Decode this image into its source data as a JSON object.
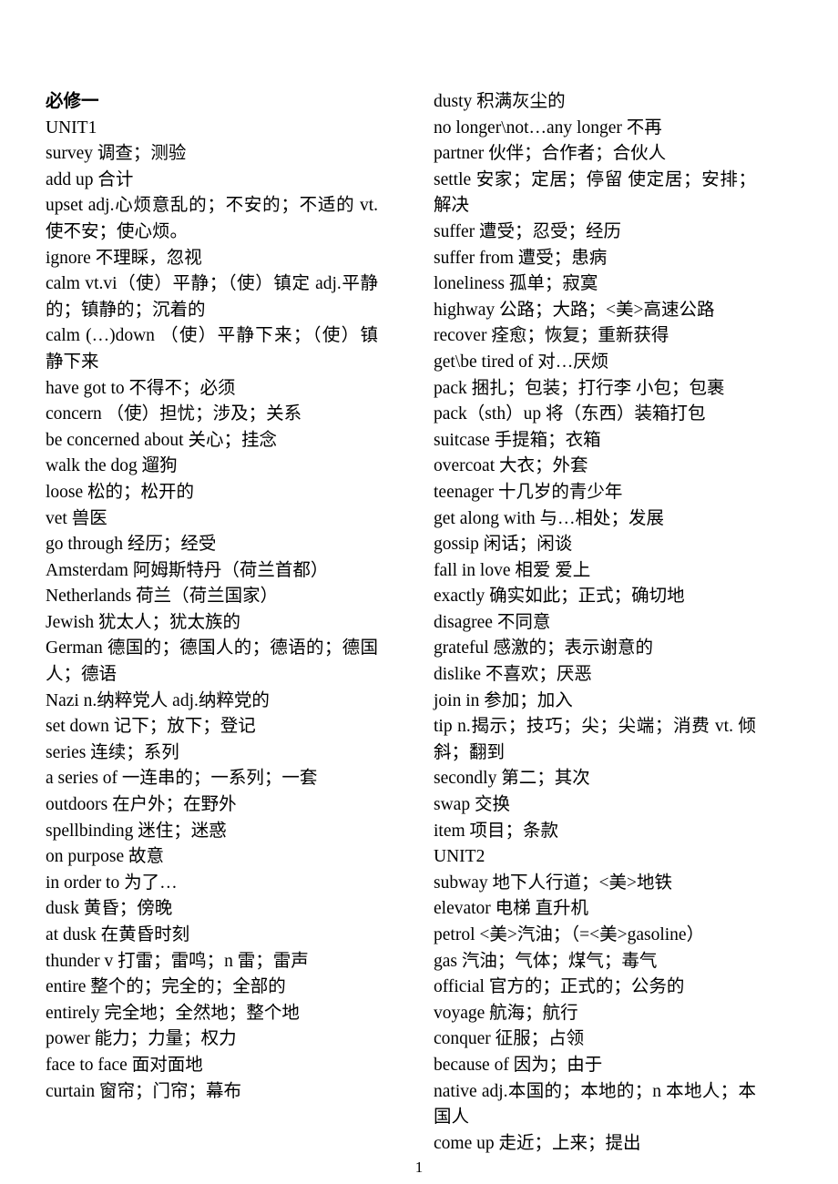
{
  "document": {
    "page_number": "1",
    "columns": [
      {
        "id": "left",
        "entries": [
          {
            "text": "必修一",
            "bold": true
          },
          {
            "text": "UNIT1",
            "bold": false
          },
          {
            "text": "survey    调查；测验",
            "bold": false
          },
          {
            "text": "add up    合计",
            "bold": false
          },
          {
            "text": "upset       adj.心烦意乱的；不安的；不适的  vt.使不安；使心烦。",
            "bold": false
          },
          {
            "text": "ignore     不理睬，忽视",
            "bold": false
          },
          {
            "text": "calm        vt.vi（使）平静；（使）镇定 adj.平静的；镇静的；沉着的",
            "bold": false
          },
          {
            "text": "calm (…)down     （使）平静下来；（使）镇静下来",
            "bold": false
          },
          {
            "text": "have got to    不得不；必须",
            "bold": false
          },
          {
            "text": "concern     （使）担忧；涉及；关系",
            "bold": false
          },
          {
            "text": "be concerned about    关心；挂念",
            "bold": false
          },
          {
            "text": "walk the dog  遛狗",
            "bold": false
          },
          {
            "text": "loose    松的；松开的",
            "bold": false
          },
          {
            "text": "vet    兽医",
            "bold": false
          },
          {
            "text": "go through    经历；经受",
            "bold": false
          },
          {
            "text": "Amsterdam    阿姆斯特丹（荷兰首都）",
            "bold": false
          },
          {
            "text": "Netherlands   荷兰（荷兰国家）",
            "bold": false
          },
          {
            "text": "Jewish   犹太人；犹太族的",
            "bold": false
          },
          {
            "text": "German  德国的；德国人的；德语的；德国人；德语",
            "bold": false
          },
          {
            "text": "Nazi    n.纳粹党人 adj.纳粹党的",
            "bold": false
          },
          {
            "text": "set down  记下；放下；登记",
            "bold": false
          },
          {
            "text": "series    连续；系列",
            "bold": false
          },
          {
            "text": "a series of    一连串的；一系列；一套",
            "bold": false
          },
          {
            "text": "outdoors    在户外；在野外",
            "bold": false
          },
          {
            "text": "spellbinding     迷住；迷惑",
            "bold": false
          },
          {
            "text": "on purpose  故意",
            "bold": false
          },
          {
            "text": "in order to    为了…",
            "bold": false
          },
          {
            "text": "dusk  黄昏；傍晚",
            "bold": false
          },
          {
            "text": "at dusk  在黄昏时刻",
            "bold": false
          },
          {
            "text": "thunder    v 打雷；雷鸣；n 雷；雷声",
            "bold": false
          },
          {
            "text": "entire    整个的；完全的；全部的",
            "bold": false
          },
          {
            "text": "entirely    完全地；全然地；整个地",
            "bold": false
          },
          {
            "text": "power    能力；力量；权力",
            "bold": false
          },
          {
            "text": "face to face  面对面地",
            "bold": false
          },
          {
            "text": "curtain  窗帘；门帘；幕布",
            "bold": false
          }
        ]
      },
      {
        "id": "right",
        "entries": [
          {
            "text": "dusty  积满灰尘的",
            "bold": false
          },
          {
            "text": "no longer\\not…any longer  不再",
            "bold": false
          },
          {
            "text": "partner    伙伴；合作者；合伙人",
            "bold": false
          },
          {
            "text": "settle    安家；定居；停留 使定居；安排；解决",
            "bold": false
          },
          {
            "text": "suffer    遭受；忍受；经历",
            "bold": false
          },
          {
            "text": "suffer from  遭受；患病",
            "bold": false
          },
          {
            "text": "loneliness    孤单；寂寞",
            "bold": false
          },
          {
            "text": "highway  公路；大路；<美>高速公路",
            "bold": false
          },
          {
            "text": "recover    痊愈；恢复；重新获得",
            "bold": false
          },
          {
            "text": "get\\be tired of   对…厌烦",
            "bold": false
          },
          {
            "text": "pack  捆扎；包装；打行李   小包；包裹",
            "bold": false
          },
          {
            "text": "pack（sth）up  将（东西）装箱打包",
            "bold": false
          },
          {
            "text": "suitcase  手提箱；衣箱",
            "bold": false
          },
          {
            "text": "overcoat  大衣；外套",
            "bold": false
          },
          {
            "text": "teenager  十几岁的青少年",
            "bold": false
          },
          {
            "text": "get along with  与…相处；发展",
            "bold": false
          },
          {
            "text": "gossip  闲话；闲谈",
            "bold": false
          },
          {
            "text": "fall in love  相爱  爱上",
            "bold": false
          },
          {
            "text": "exactly  确实如此；正式；确切地",
            "bold": false
          },
          {
            "text": "disagree  不同意",
            "bold": false
          },
          {
            "text": "grateful  感激的；表示谢意的",
            "bold": false
          },
          {
            "text": "dislike  不喜欢；厌恶",
            "bold": false
          },
          {
            "text": "join in  参加；加入",
            "bold": false
          },
          {
            "text": "tip      n.揭示；技巧；尖；尖端；消费    vt. 倾斜；翻到",
            "bold": false
          },
          {
            "text": "secondly  第二；其次",
            "bold": false
          },
          {
            "text": "swap    交换",
            "bold": false
          },
          {
            "text": "item  项目；条款",
            "bold": false
          },
          {
            "text": "UNIT2",
            "bold": false
          },
          {
            "text": "subway  地下人行道；<美>地铁",
            "bold": false
          },
          {
            "text": "elevator  电梯  直升机",
            "bold": false
          },
          {
            "text": "petrol    <美>汽油；（=<美>gasoline）",
            "bold": false
          },
          {
            "text": "gas    汽油；气体；煤气；毒气",
            "bold": false
          },
          {
            "text": "official    官方的；正式的；公务的",
            "bold": false
          },
          {
            "text": "voyage    航海；航行",
            "bold": false
          },
          {
            "text": "conquer    征服；占领",
            "bold": false
          },
          {
            "text": "because of   因为；由于",
            "bold": false
          },
          {
            "text": "native     adj.本国的；本地的；n 本地人；本国人",
            "bold": false
          },
          {
            "text": "come up  走近；上来；提出",
            "bold": false
          }
        ]
      }
    ]
  }
}
